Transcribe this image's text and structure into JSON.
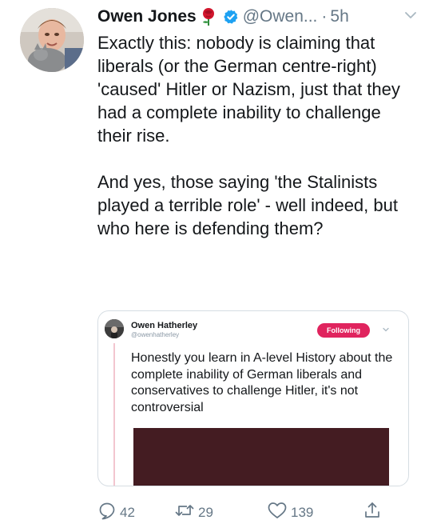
{
  "tweet": {
    "author_name": "Owen Jones",
    "author_handle": "@Owen...",
    "separator": "·",
    "time": "5h",
    "paragraphs": [
      "Exactly this: nobody is claiming that liberals (or the German centre-right) 'caused' Hitler or Nazism, just that they had a complete inability to challenge their rise.",
      "And yes, those saying 'the Stalinists played a terrible role' - well indeed, but who here is defending them?"
    ],
    "icons": {
      "emoji": "rose-icon",
      "verified": "verified-badge-icon",
      "menu": "chevron-down-icon"
    }
  },
  "quoted_tweet": {
    "author_name": "Owen Hatherley",
    "author_handle": "@owenhatherley",
    "follow_label": "Following",
    "text": "Honestly you learn in A-level History about the complete inability of German liberals and conservatives to challenge Hitler, it's not controversial"
  },
  "actions": {
    "reply_count": "42",
    "retweet_count": "29",
    "like_count": "139"
  },
  "colors": {
    "accent_blue": "#1da1f2",
    "muted_text": "#657786",
    "follow_button": "#e0245e",
    "media_fill": "#441c22"
  }
}
